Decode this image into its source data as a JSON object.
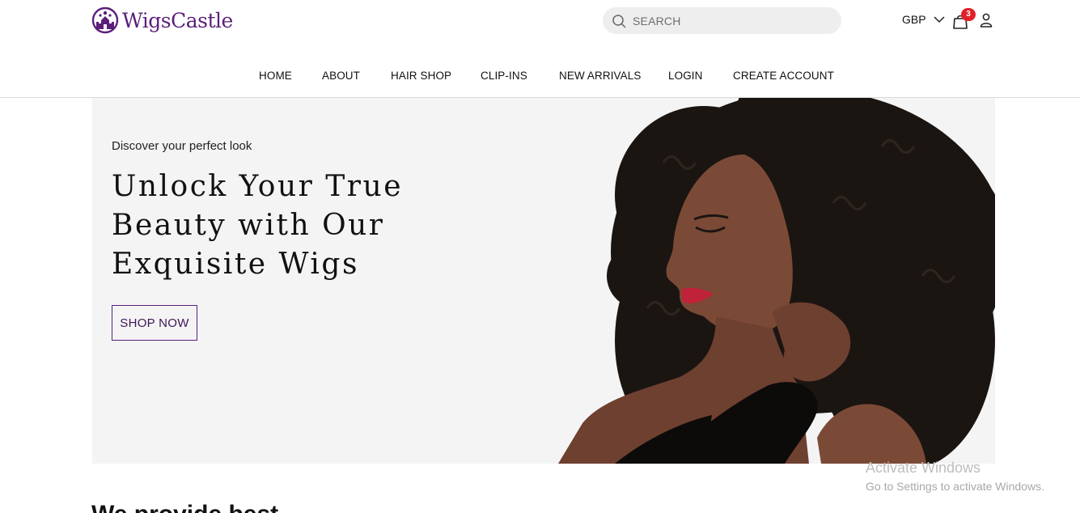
{
  "brand": {
    "name": "WigsCastle",
    "color": "#5b1f7a"
  },
  "search": {
    "placeholder": "SEARCH",
    "value": ""
  },
  "currency": {
    "selected": "GBP"
  },
  "cart": {
    "count": "3"
  },
  "nav": {
    "items": [
      {
        "label": "HOME"
      },
      {
        "label": "ABOUT"
      },
      {
        "label": "HAIR SHOP"
      },
      {
        "label": "CLIP-INS"
      },
      {
        "label": "NEW ARRIVALS"
      },
      {
        "label": "LOGIN"
      },
      {
        "label": "CREATE ACCOUNT"
      }
    ]
  },
  "hero": {
    "eyebrow": "Discover your perfect look",
    "title": "Unlock Your True Beauty with Our Exquisite Wigs",
    "cta": "SHOP NOW"
  },
  "next_section": {
    "heading": "We provide best"
  },
  "watermark": {
    "title": "Activate Windows",
    "subtitle": "Go to Settings to activate Windows."
  },
  "colors": {
    "accent": "#5b1f7a",
    "badge": "#e0212a",
    "hero_bg": "#f4f4f5"
  }
}
